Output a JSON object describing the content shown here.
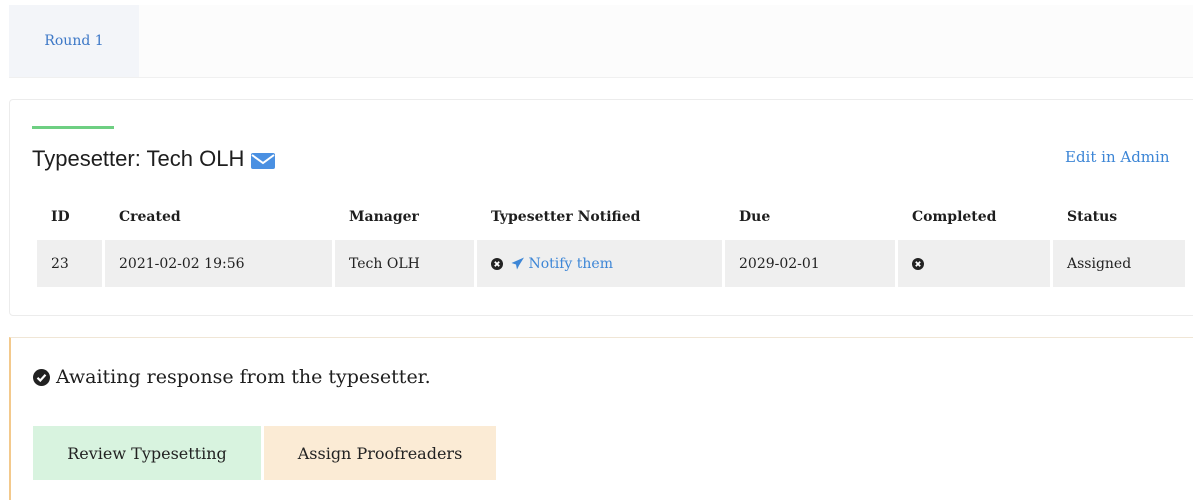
{
  "tabs": [
    {
      "label": "Round 1"
    }
  ],
  "typesetter_card": {
    "title": "Typesetter: Tech OLH",
    "edit_link": "Edit in Admin",
    "columns": [
      "ID",
      "Created",
      "Manager",
      "Typesetter Notified",
      "Due",
      "Completed",
      "Status"
    ],
    "row": {
      "id": "23",
      "created": "2021-02-02 19:56",
      "manager": "Tech OLH",
      "notify_label": "Notify them",
      "due": "2029-02-01",
      "status": "Assigned"
    }
  },
  "notice": {
    "message": "Awaiting response from the typesetter.",
    "review_button": "Review Typesetting",
    "assign_button": "Assign Proofreaders"
  },
  "icons": {
    "envelope": "envelope-icon",
    "not_done": "times-circle-icon",
    "notify": "paper-plane-icon",
    "check": "check-circle-icon"
  },
  "colors": {
    "link": "#3d86d6",
    "accent": "#6ecf82",
    "review_button_bg": "#d8f3df",
    "assign_button_bg": "#fbebd5"
  }
}
